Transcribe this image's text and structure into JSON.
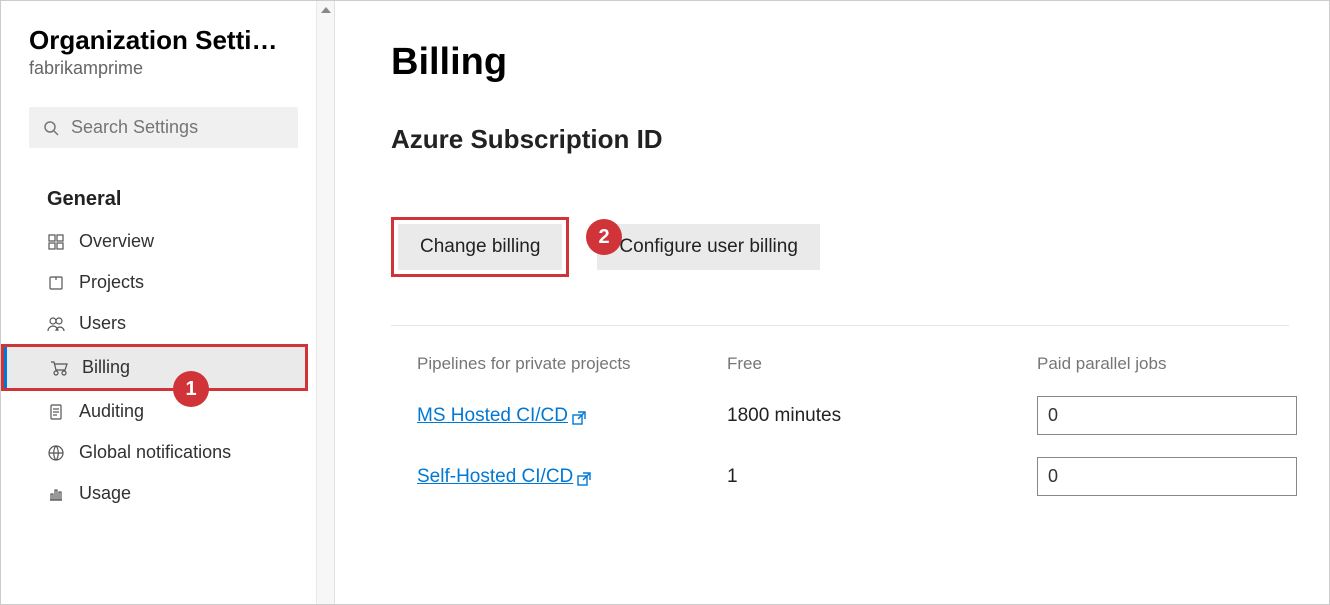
{
  "sidebar": {
    "title": "Organization Settin…",
    "org": "fabrikamprime",
    "search_placeholder": "Search Settings",
    "section_label": "General",
    "items": [
      {
        "icon": "overview",
        "label": "Overview"
      },
      {
        "icon": "projects",
        "label": "Projects"
      },
      {
        "icon": "users",
        "label": "Users"
      },
      {
        "icon": "billing",
        "label": "Billing",
        "active": true
      },
      {
        "icon": "auditing",
        "label": "Auditing"
      },
      {
        "icon": "notifications",
        "label": "Global notifications"
      },
      {
        "icon": "usage",
        "label": "Usage"
      }
    ]
  },
  "callouts": {
    "one": "1",
    "two": "2"
  },
  "main": {
    "title": "Billing",
    "subscription_heading": "Azure Subscription ID",
    "buttons": {
      "change_billing": "Change billing",
      "configure_user_billing": "Configure user billing"
    },
    "table": {
      "headers": {
        "col1": "Pipelines for private projects",
        "col2": "Free",
        "col3": "Paid parallel jobs"
      },
      "rows": [
        {
          "name": "MS Hosted CI/CD",
          "free": "1800 minutes",
          "paid": "0"
        },
        {
          "name": "Self-Hosted CI/CD",
          "free": "1",
          "paid": "0"
        }
      ]
    }
  }
}
